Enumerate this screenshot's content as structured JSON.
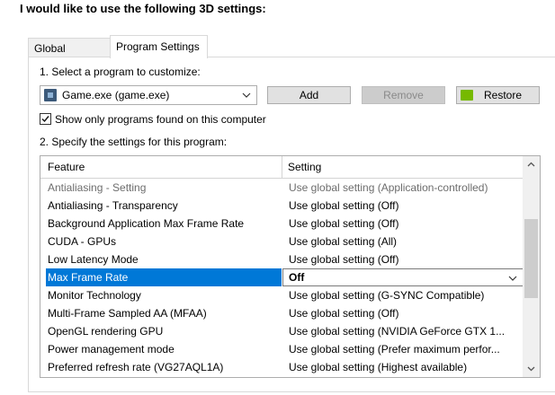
{
  "heading": "I would like to use the following 3D settings:",
  "tabs": [
    {
      "label": "Global Settings"
    },
    {
      "label": "Program Settings"
    }
  ],
  "step1": "1. Select a program to customize:",
  "program": {
    "selected": "Game.exe (game.exe)"
  },
  "buttons": {
    "add": "Add",
    "remove": "Remove",
    "restore": "Restore"
  },
  "filter": {
    "label": "Show only programs found on this computer",
    "checked": true
  },
  "step2": "2. Specify the settings for this program:",
  "table": {
    "headers": {
      "feature": "Feature",
      "setting": "Setting"
    },
    "rows": [
      {
        "feature": "Antialiasing - Setting",
        "setting": "Use global setting (Application-controlled)"
      },
      {
        "feature": "Antialiasing - Transparency",
        "setting": "Use global setting (Off)"
      },
      {
        "feature": "Background Application Max Frame Rate",
        "setting": "Use global setting (Off)"
      },
      {
        "feature": "CUDA - GPUs",
        "setting": "Use global setting (All)"
      },
      {
        "feature": "Low Latency Mode",
        "setting": "Use global setting (Off)"
      },
      {
        "feature": "Max Frame Rate",
        "setting": "Off"
      },
      {
        "feature": "Monitor Technology",
        "setting": "Use global setting (G-SYNC Compatible)"
      },
      {
        "feature": "Multi-Frame Sampled AA (MFAA)",
        "setting": "Use global setting (Off)"
      },
      {
        "feature": "OpenGL rendering GPU",
        "setting": "Use global setting (NVIDIA GeForce GTX 1..."
      },
      {
        "feature": "Power management mode",
        "setting": "Use global setting (Prefer maximum perfor..."
      },
      {
        "feature": "Preferred refresh rate (VG27AQL1A)",
        "setting": "Use global setting (Highest available)"
      }
    ]
  },
  "colors": {
    "selection": "#0078d7",
    "nvidia": "#76b900"
  }
}
